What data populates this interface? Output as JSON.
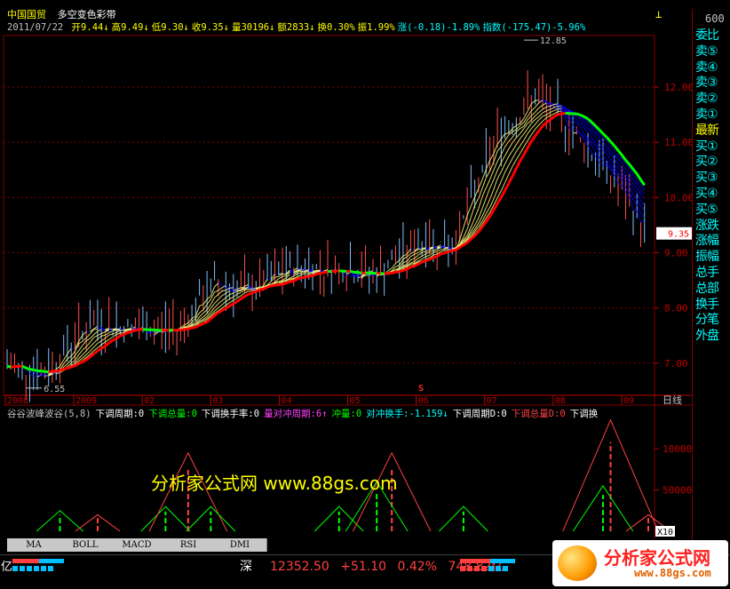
{
  "header": {
    "stock_name": "中国国贸",
    "indicator_name": "多空变色彩带",
    "date": "2011/07/22",
    "fields": [
      {
        "label": "开9.44↓",
        "color": "#ffff00"
      },
      {
        "label": "高9.49↓",
        "color": "#ffff00"
      },
      {
        "label": "低9.30↓",
        "color": "#ffff00"
      },
      {
        "label": "收9.35↓",
        "color": "#ffff00"
      },
      {
        "label": "量30196↓",
        "color": "#ffff00"
      },
      {
        "label": "额2833↓",
        "color": "#ffff00"
      },
      {
        "label": "换0.30%",
        "color": "#ffff00"
      },
      {
        "label": "振1.99%",
        "color": "#ffff00"
      },
      {
        "label": "涨(-0.18)-1.89%",
        "color": "#00ffff"
      },
      {
        "label": "指数(-175.47)-5.96%",
        "color": "#00ffff"
      }
    ]
  },
  "main_chart": {
    "y_ticks": [
      "12.00",
      "11.00",
      "10.00",
      "9.00",
      "8.00",
      "7.00"
    ],
    "y_values": [
      12,
      11,
      10,
      9,
      8,
      7
    ],
    "ylim": [
      6.45,
      12.9
    ],
    "high_label": "12.85",
    "low_label": "6.55",
    "last_price_label": "9.35",
    "x_ticks": [
      "2008",
      "2009",
      "02",
      "03",
      "04",
      "05",
      "06",
      "07",
      "08",
      "09"
    ],
    "period_label": "日线",
    "marker_label": "S",
    "colors": {
      "up_ribbon": "#ffff80",
      "down_ribbon": "#0000ff",
      "green_line": "#00ff00",
      "red_line": "#ff0000",
      "candles_up": "#ff5050",
      "candles_down": "#80c0ff",
      "grid": "#800000"
    }
  },
  "lower_chart": {
    "header": [
      {
        "text": "谷谷波峰波谷(5,8)",
        "color": "#c0c0c0"
      },
      {
        "text": "下调周期:0",
        "color": "#ffffff"
      },
      {
        "text": "下调总量:0",
        "color": "#00ff00"
      },
      {
        "text": "下调换手率:0",
        "color": "#ffffff"
      },
      {
        "text": "量对冲周期:6↑",
        "color": "#ff40ff"
      },
      {
        "text": "冲量:0",
        "color": "#00ff00"
      },
      {
        "text": "对冲换手:-1.159↓",
        "color": "#00ffff"
      },
      {
        "text": "下调周期D:0",
        "color": "#ffffff"
      },
      {
        "text": "下调总量D:0",
        "color": "#ff4040"
      },
      {
        "text": "下调换",
        "color": "#ffffff"
      }
    ],
    "y_ticks": [
      "100000",
      "50000",
      "0"
    ],
    "y_values": [
      100000,
      50000,
      0
    ],
    "ylim": [
      0,
      140000
    ],
    "unit_label": "X10"
  },
  "tabs": [
    "MA",
    "BOLL",
    "MACD",
    "RSI",
    "DMI"
  ],
  "right_panel": {
    "code": "600",
    "items": [
      "委比",
      "卖⑤",
      "卖④",
      "卖③",
      "卖②",
      "卖①",
      "最新",
      "买①",
      "买②",
      "买③",
      "买④",
      "买⑤",
      "涨跌",
      "涨幅",
      "振幅",
      "总手",
      "总部",
      "换手",
      "分笔",
      "外盘"
    ]
  },
  "status_bar": {
    "left_mark": "亿",
    "market": "深",
    "index_value": "12352.50",
    "change": "+51.10",
    "pct": "0.42%",
    "amount": "748.82亿"
  },
  "watermark": "分析家公式网 www.88gs.com",
  "logo": {
    "title": "分析家公式网",
    "url": "www.88gs.com"
  }
}
